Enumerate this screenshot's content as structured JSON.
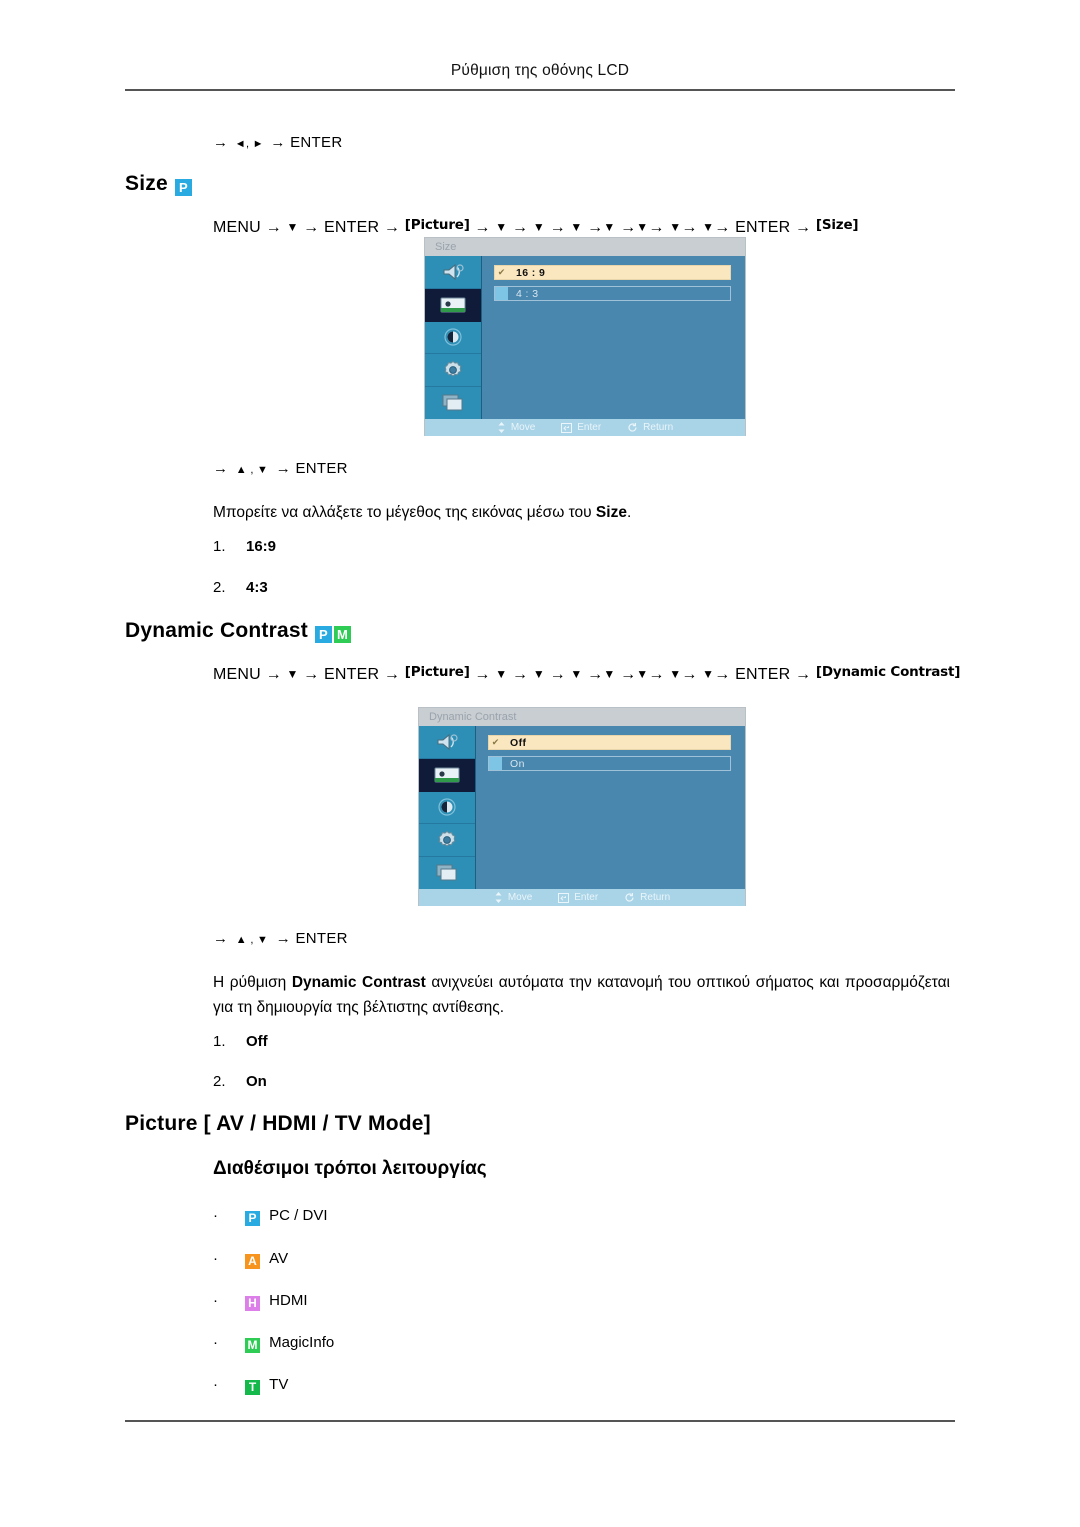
{
  "header": {
    "title": "Ρύθμιση της οθόνης LCD"
  },
  "top_keyline": {
    "prefix": "→",
    "keys": "◄, ►",
    "suffix": "→ ENTER"
  },
  "sections": [
    {
      "id": "size",
      "heading": "Size",
      "badges": [
        {
          "letter": "P",
          "color": "#29abe2"
        }
      ],
      "path": {
        "start": "MENU",
        "first_chip": "Picture",
        "enter": "ENTER",
        "end_chip": "Size",
        "down_count": 7
      },
      "keyline": {
        "prefix": "→",
        "keys": "▲ , ▼",
        "suffix": "→ ENTER"
      },
      "description_pre": "Μπορείτε να αλλάξετε το μέγεθος της εικόνας μέσω του ",
      "description_bold": "Size",
      "description_post": ".",
      "options": [
        {
          "num": "1.",
          "label": "16:9"
        },
        {
          "num": "2.",
          "label": "4:3"
        }
      ],
      "osd": {
        "title": "Size",
        "rows": [
          {
            "label": "16 : 9",
            "selected": true
          },
          {
            "label": "4 : 3",
            "selected": false
          }
        ],
        "footer": [
          {
            "icon": "move-icon",
            "label": "Move"
          },
          {
            "icon": "enter-icon",
            "label": "Enter"
          },
          {
            "icon": "return-icon",
            "label": "Return"
          }
        ]
      }
    },
    {
      "id": "dynamic-contrast",
      "heading": "Dynamic Contrast",
      "badges": [
        {
          "letter": "P",
          "color": "#29abe2"
        },
        {
          "letter": "M",
          "color": "#2ecc55"
        }
      ],
      "path": {
        "start": "MENU",
        "first_chip": "Picture",
        "enter": "ENTER",
        "end_chip": "Dynamic Contrast",
        "down_count": 7
      },
      "keyline": {
        "prefix": "→",
        "keys": "▲ , ▼",
        "suffix": "→ ENTER"
      },
      "description_pre": "Η ρύθμιση ",
      "description_bold": "Dynamic Contrast",
      "description_post": " ανιχνεύει αυτόματα την κατανομή του οπτικού σήματος και προσαρμόζεται για τη δημιουργία της βέλτιστης αντίθεσης.",
      "options": [
        {
          "num": "1.",
          "label": "Off"
        },
        {
          "num": "2.",
          "label": "On"
        }
      ],
      "osd": {
        "title": "Dynamic Contrast",
        "rows": [
          {
            "label": "Off",
            "selected": true
          },
          {
            "label": "On",
            "selected": false
          }
        ],
        "footer": [
          {
            "icon": "move-icon",
            "label": "Move"
          },
          {
            "icon": "enter-icon",
            "label": "Enter"
          },
          {
            "icon": "return-icon",
            "label": "Return"
          }
        ]
      }
    }
  ],
  "picture_modes": {
    "heading": "Picture [ AV / HDMI / TV Mode]",
    "subheading": "Διαθέσιμοι τρόποι λειτουργίας",
    "items": [
      {
        "letter": "P",
        "color": "#29abe2",
        "label": "PC / DVI"
      },
      {
        "letter": "A",
        "color": "#f7941e",
        "label": "AV"
      },
      {
        "letter": "H",
        "color": "#dd7fe8",
        "label": "HDMI"
      },
      {
        "letter": "M",
        "color": "#2ecc55",
        "label": "MagicInfo"
      },
      {
        "letter": "T",
        "color": "#14b84b",
        "label": "TV"
      }
    ]
  },
  "osd_sidebar_icons": [
    "sound-icon",
    "picture-icon",
    "contrast-icon",
    "setup-icon",
    "multiscreen-icon"
  ]
}
